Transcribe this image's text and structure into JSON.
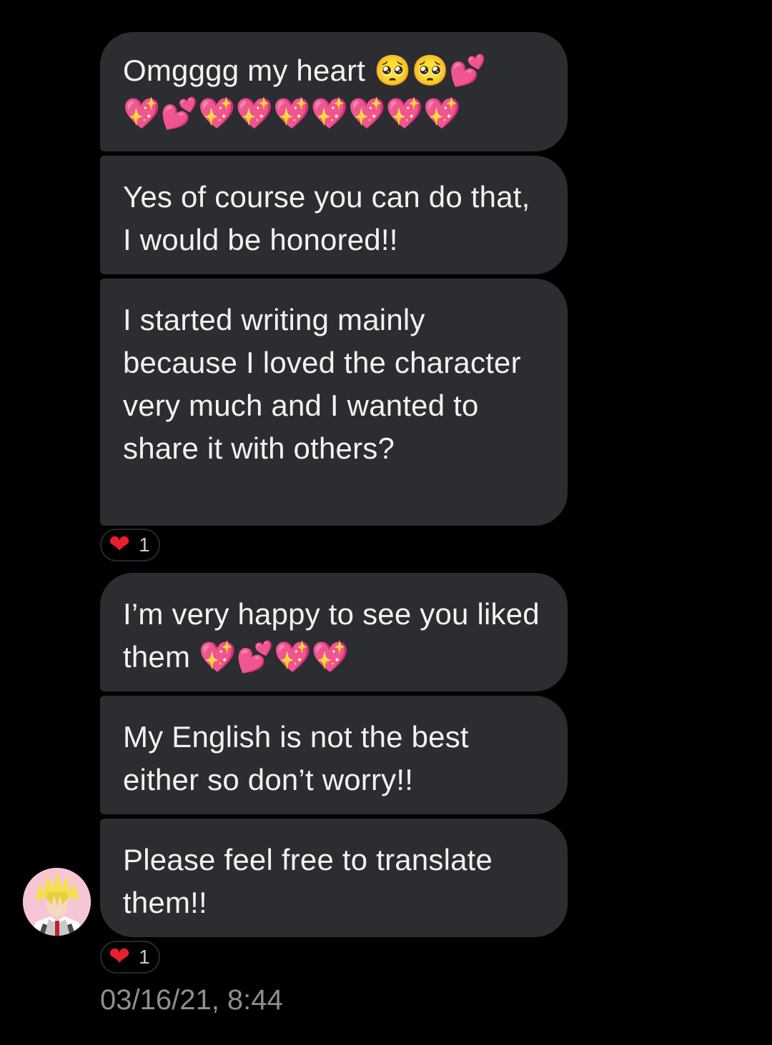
{
  "messages": [
    {
      "text": "Omgggg my heart ",
      "emojis_inline": "🥺🥺💕",
      "emojis_line2": "💖💕💖💖💖💖💖💖💖"
    },
    {
      "text": "Yes of course you can do that, I would be honored!!"
    },
    {
      "text": "I started writing mainly because I loved the character very much and I wanted to share it with others?"
    },
    {
      "text": "I’m very happy to see you liked them ",
      "emojis_inline": "💖💕💖💖"
    },
    {
      "text": "My English is not the best either so don’t worry!!"
    },
    {
      "text": "Please feel free to translate them!!"
    }
  ],
  "reactions": [
    {
      "emoji": "❤",
      "count": "1"
    },
    {
      "emoji": "❤",
      "count": "1"
    }
  ],
  "timestamp": "03/16/21, 8:44",
  "avatar": {
    "icon": "anime-character-avatar-icon"
  },
  "colors": {
    "background": "#000000",
    "bubble": "#2b2d31",
    "text": "#f2f2f2",
    "timestamp": "#8e8e8e",
    "reaction_heart": "#e8202e"
  }
}
